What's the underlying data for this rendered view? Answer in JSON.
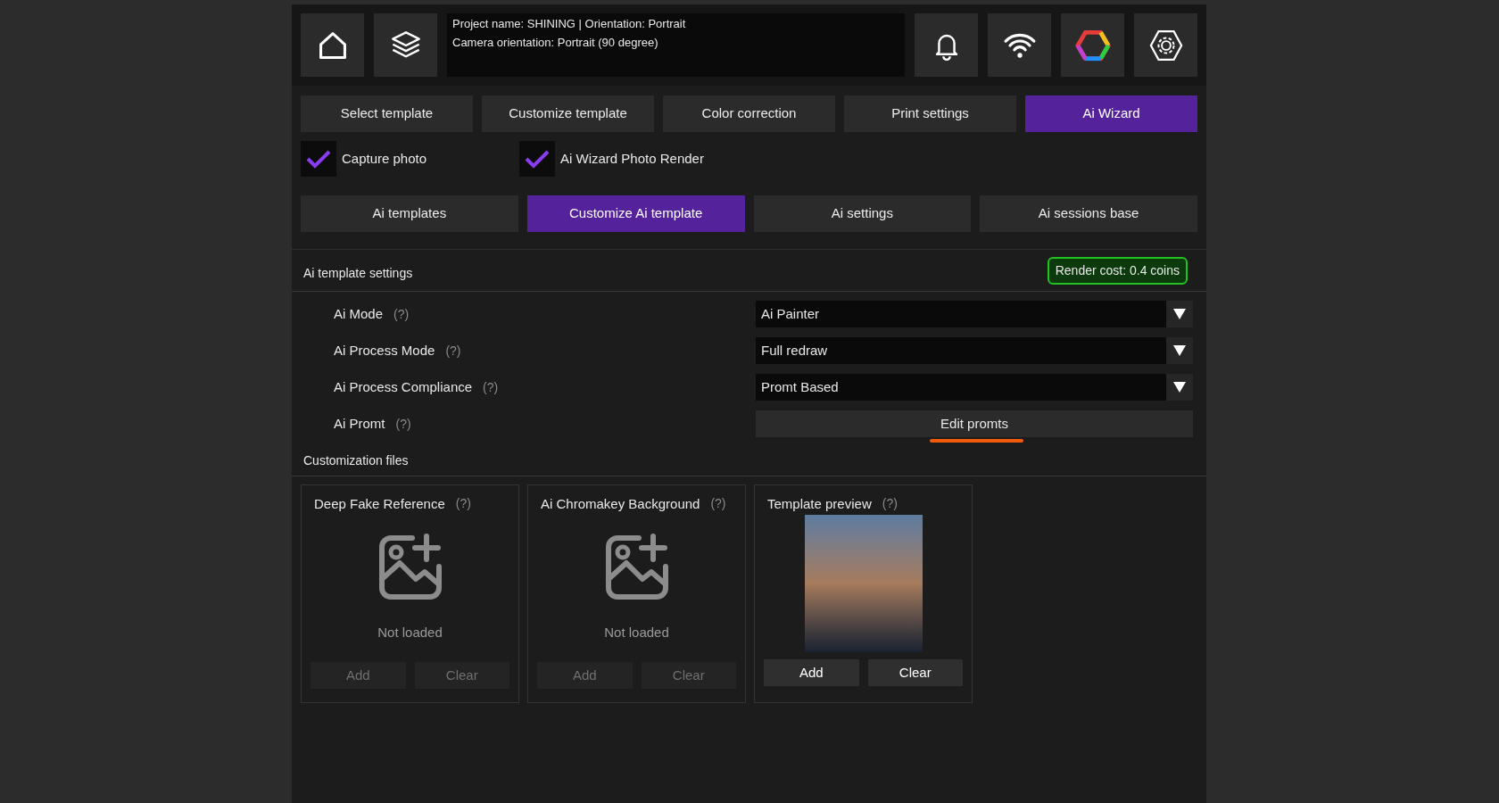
{
  "header": {
    "info_lines": [
      "Project name: SHINING | Orientation: Portrait",
      "Camera orientation: Portrait (90 degree)"
    ]
  },
  "main_tabs": [
    {
      "label": "Select template",
      "selected": false
    },
    {
      "label": "Customize template",
      "selected": false
    },
    {
      "label": "Color correction",
      "selected": false
    },
    {
      "label": "Print settings",
      "selected": false
    },
    {
      "label": "Ai Wizard",
      "selected": true
    }
  ],
  "options": [
    {
      "label": "Capture photo",
      "checked": true
    },
    {
      "label": "Ai Wizard Photo Render",
      "checked": true
    }
  ],
  "sub_tabs": [
    {
      "label": "Ai templates",
      "selected": false
    },
    {
      "label": "Customize Ai template",
      "selected": true
    },
    {
      "label": "Ai settings",
      "selected": false
    },
    {
      "label": "Ai sessions base",
      "selected": false
    }
  ],
  "settings": {
    "title": "Ai template settings",
    "render_cost": "Render cost: 0.4 coins",
    "rows": [
      {
        "label": "Ai Mode",
        "help": "(?)",
        "kind": "dropdown",
        "value": "Ai Painter"
      },
      {
        "label": "Ai Process Mode",
        "help": "(?)",
        "kind": "dropdown",
        "value": "Full redraw"
      },
      {
        "label": "Ai Process Compliance",
        "help": "(?)",
        "kind": "dropdown",
        "value": "Promt Based"
      },
      {
        "label": "Ai Promt",
        "help": "(?)",
        "kind": "button",
        "value": "Edit promts"
      }
    ]
  },
  "files": {
    "title": "Customization files",
    "cards": [
      {
        "title": "Deep Fake Reference",
        "help": "(?)",
        "kind": "empty",
        "status": "Not loaded",
        "buttons": [
          {
            "label": "Add",
            "disabled": true
          },
          {
            "label": "Clear",
            "disabled": true
          }
        ]
      },
      {
        "title": "Ai Chromakey Background",
        "help": "(?)",
        "kind": "empty",
        "status": "Not loaded",
        "buttons": [
          {
            "label": "Add",
            "disabled": true
          },
          {
            "label": "Clear",
            "disabled": true
          }
        ]
      },
      {
        "title": "Template preview",
        "help": "(?)",
        "kind": "photo",
        "buttons": [
          {
            "label": "Add",
            "disabled": false
          },
          {
            "label": "Clear",
            "disabled": false
          }
        ]
      }
    ]
  }
}
